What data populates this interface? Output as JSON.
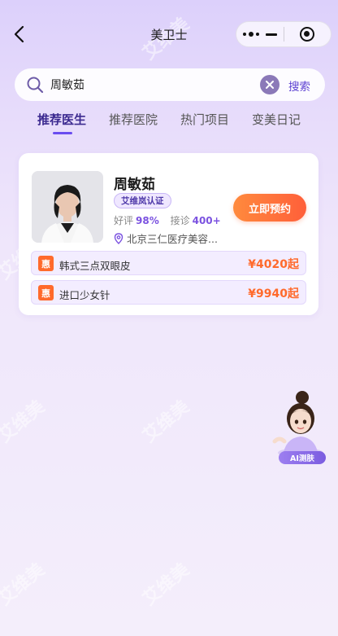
{
  "nav": {
    "title": "美卫士"
  },
  "search": {
    "query": "周敏茹",
    "button_label": "搜索"
  },
  "tabs": [
    {
      "label": "推荐医生",
      "active": true
    },
    {
      "label": "推荐医院",
      "active": false
    },
    {
      "label": "热门项目",
      "active": false
    },
    {
      "label": "变美日记",
      "active": false
    }
  ],
  "doctor": {
    "name": "周敏茹",
    "cert_badge": "艾维岚认证",
    "rating_label": "好评",
    "rating_value": "98%",
    "consult_label": "接诊",
    "consult_value": "400+",
    "location": "北京三仁医疗美容...",
    "book_button": "立即预约",
    "services": [
      {
        "badge": "惠",
        "name": "韩式三点双眼皮",
        "price": "¥4020起"
      },
      {
        "badge": "惠",
        "name": "进口少女针",
        "price": "¥9940起"
      }
    ]
  },
  "ai_float": {
    "label": "AI测肤"
  },
  "colors": {
    "accent": "#6a4df0",
    "price": "#ff6a2c",
    "book_button": "#ff6f3b",
    "background_top": "#dcd0fb"
  }
}
